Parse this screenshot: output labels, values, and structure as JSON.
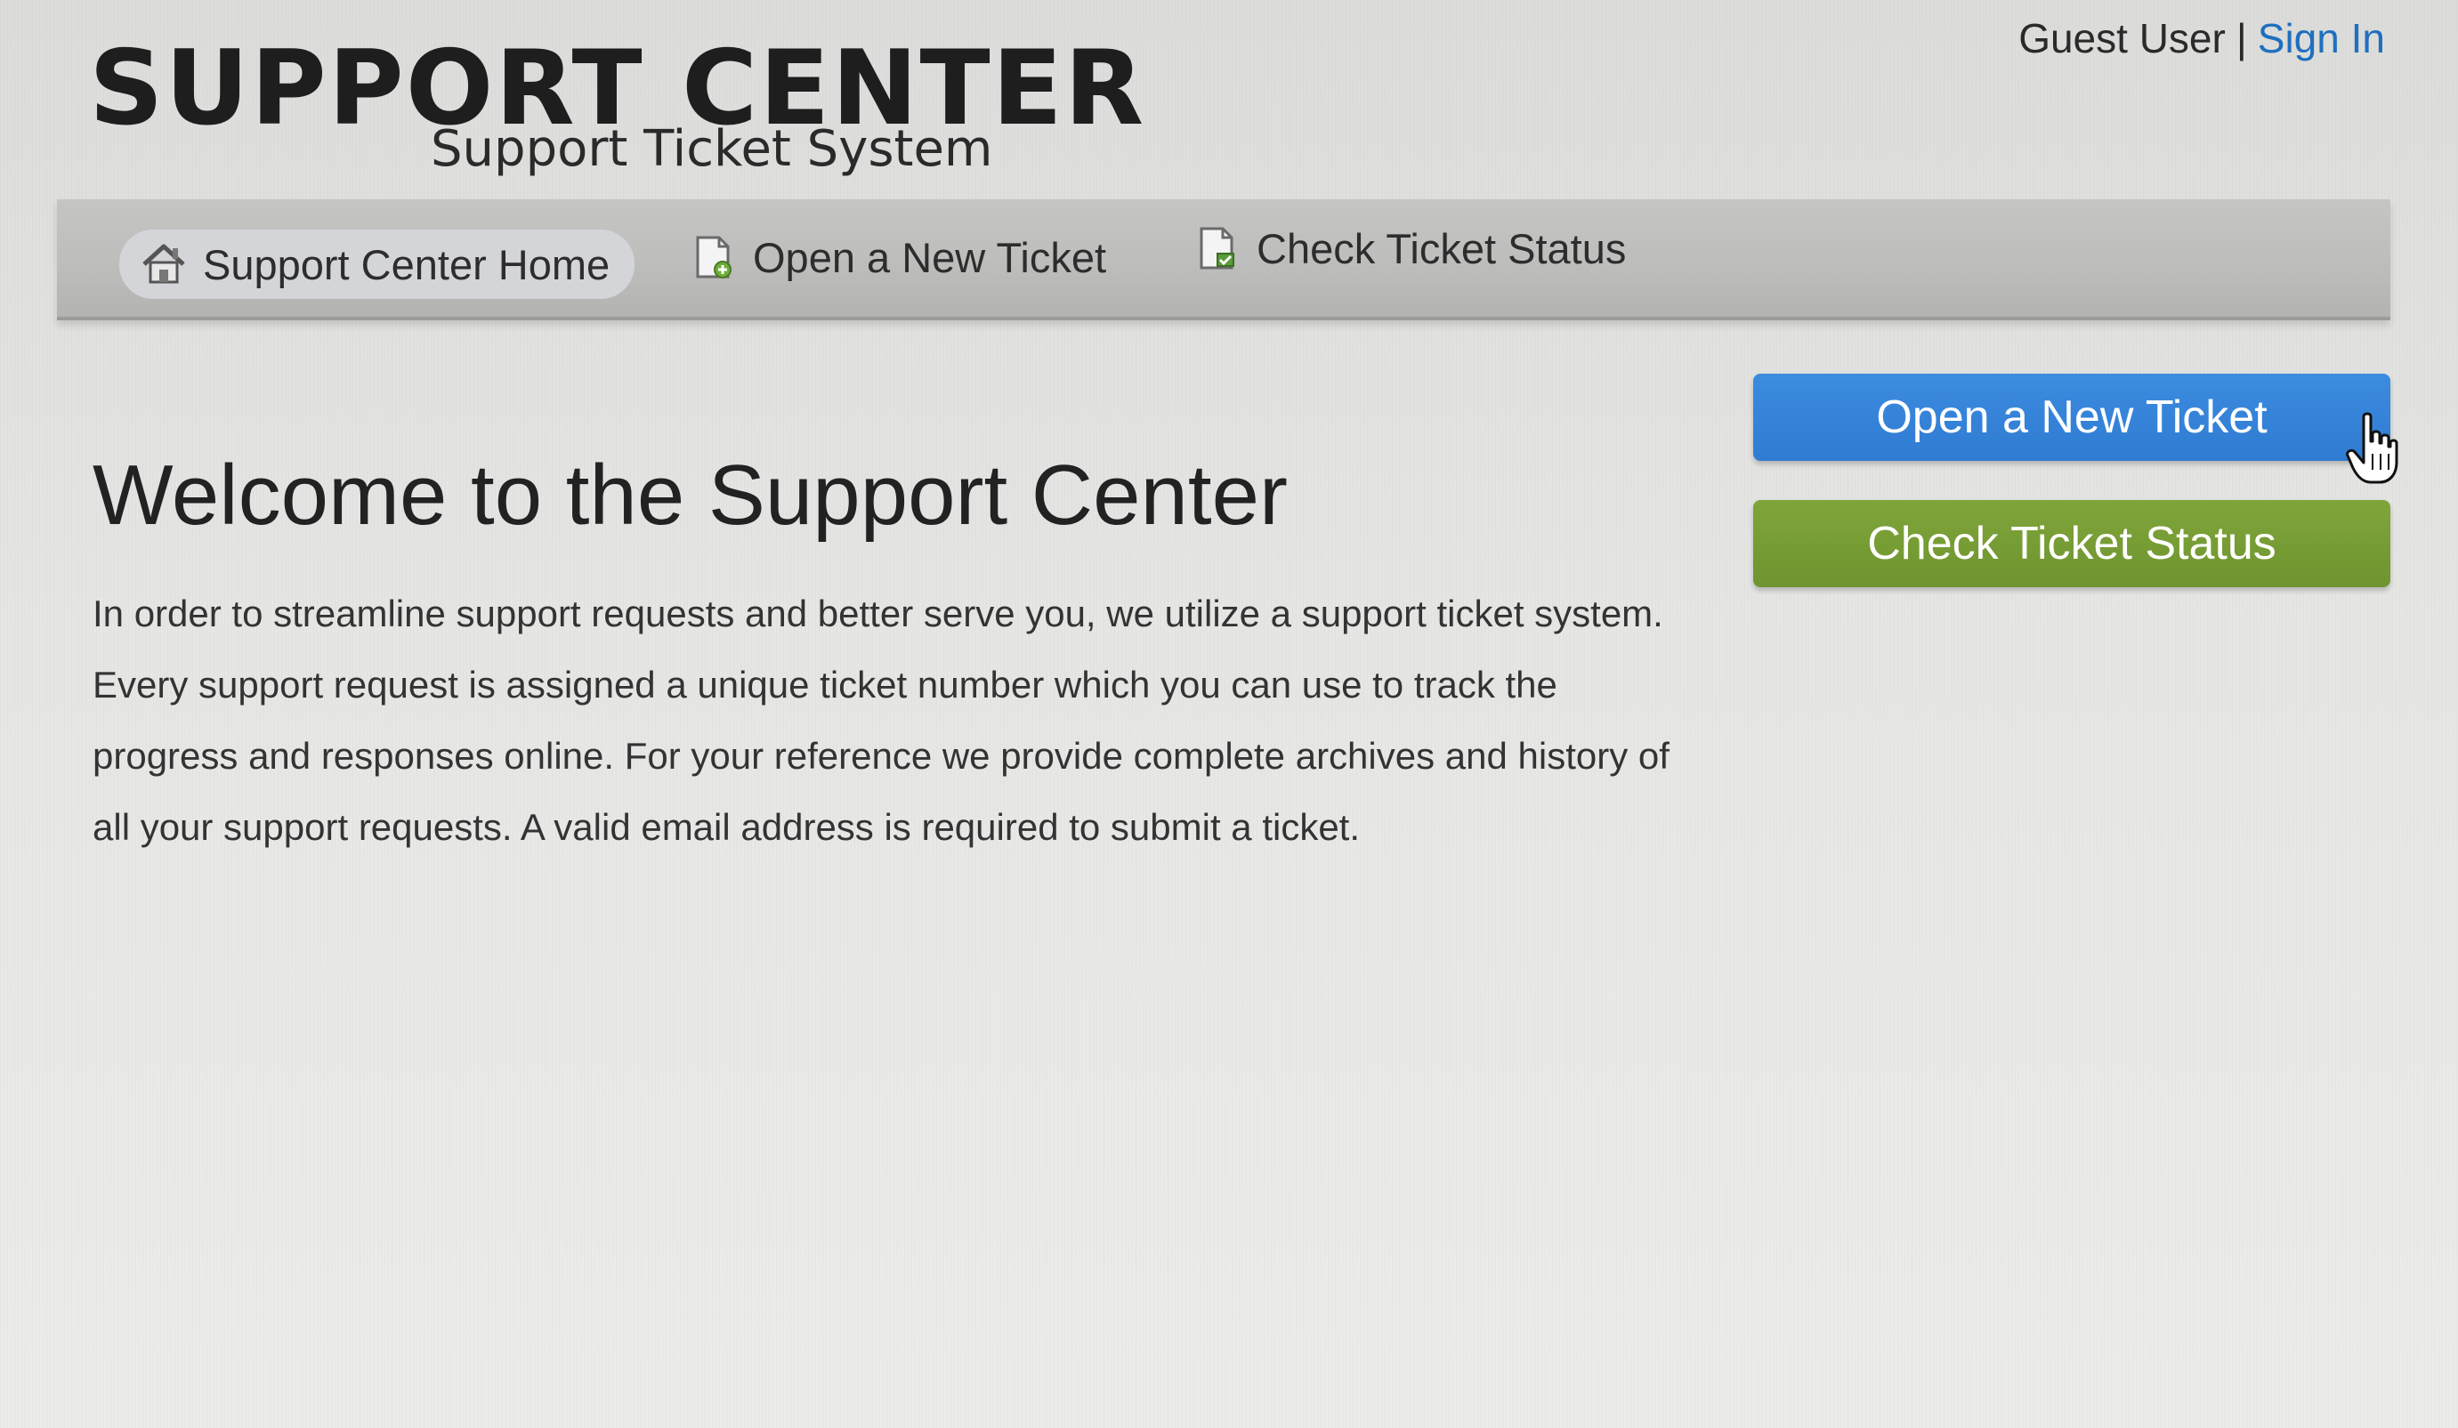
{
  "header": {
    "title": "SUPPORT CENTER",
    "subtitle": "Support Ticket System"
  },
  "user_bar": {
    "user": "Guest User",
    "separator": "|",
    "sign_in": "Sign In"
  },
  "nav": {
    "items": [
      {
        "label": "Support Center Home",
        "icon": "home-icon",
        "active": true
      },
      {
        "label": "Open a New Ticket",
        "icon": "new-ticket-icon",
        "active": false
      },
      {
        "label": "Check Ticket Status",
        "icon": "ticket-status-icon",
        "active": false
      }
    ]
  },
  "main": {
    "heading": "Welcome to the Support Center",
    "intro": "In order to streamline support requests and better serve you, we utilize a support ticket system. Every support request is assigned a unique ticket number which you can use to track the progress and responses online. For your reference we provide complete archives and history of all your support requests. A valid email address is required to submit a ticket."
  },
  "sidebar": {
    "open_ticket": "Open a New Ticket",
    "check_status": "Check Ticket Status"
  },
  "colors": {
    "link": "#1f6fbf",
    "open_button": "#3385d8",
    "status_button": "#779c35",
    "nav_bar": "#bdbdbb"
  }
}
